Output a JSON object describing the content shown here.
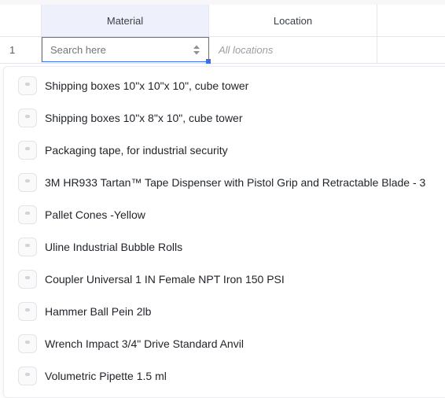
{
  "grid": {
    "columns": {
      "material": "Material",
      "location": "Location"
    },
    "row": {
      "number": "1",
      "location_placeholder": "All locations"
    }
  },
  "search": {
    "placeholder": "Search here",
    "value": ""
  },
  "icons": {
    "sort": "sort-updown-icon",
    "item": "product-thumbnail-icon"
  },
  "accent_color": "#3d6ee8",
  "dropdown": {
    "options": [
      {
        "label": "Shipping boxes 10\"x 10\"x 10\", cube tower"
      },
      {
        "label": "Shipping boxes 10\"x 8\"x 10\", cube tower"
      },
      {
        "label": "Packaging tape, for industrial security"
      },
      {
        "label": "3M HR933 Tartan™ Tape Dispenser with Pistol Grip and Retractable Blade - 3"
      },
      {
        "label": "Pallet Cones -Yellow"
      },
      {
        "label": "Uline Industrial Bubble Rolls"
      },
      {
        "label": "Coupler Universal 1 IN Female NPT Iron 150 PSI"
      },
      {
        "label": "Hammer Ball Pein 2lb"
      },
      {
        "label": "Wrench Impact 3/4\" Drive Standard Anvil"
      },
      {
        "label": "Volumetric Pipette 1.5 ml"
      }
    ]
  }
}
